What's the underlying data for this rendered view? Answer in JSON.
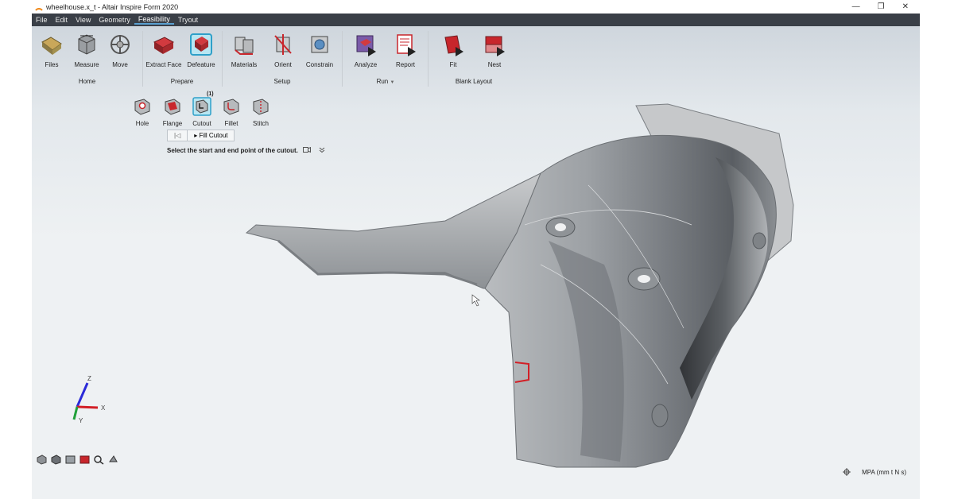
{
  "window": {
    "title": "wheelhouse.x_t - Altair Inspire Form 2020",
    "controls": [
      "—",
      "❐",
      "✕"
    ]
  },
  "menu": [
    "File",
    "Edit",
    "View",
    "Geometry",
    "Feasibility",
    "Tryout"
  ],
  "ribbon": {
    "tools": {
      "files": "Files",
      "measure": "Measure",
      "move": "Move",
      "extract_face": "Extract Face",
      "defeature": "Defeature",
      "materials": "Materials",
      "orient": "Orient",
      "constrain": "Constrain",
      "analyze": "Analyze",
      "report": "Report",
      "fit": "Fit",
      "nest": "Nest"
    },
    "groups": {
      "home": "Home",
      "prepare": "Prepare",
      "setup": "Setup",
      "run": "Run",
      "run_arrow": "▼",
      "blank_layout": "Blank Layout"
    }
  },
  "defeature": {
    "tools": {
      "hole": "Hole",
      "flange": "Flange",
      "cutout": "Cutout",
      "fillet": "Fillet",
      "stitch": "Stitch"
    },
    "cutout_badge": "(1)",
    "fill_button": "▸ Fill Cutout",
    "back_icon": "|◁"
  },
  "prompt": "Select the start and end point of the cutout.",
  "axes": {
    "z": "Z",
    "x": "X",
    "y": "Y"
  },
  "status": {
    "units": "MPA (mm t N s)"
  },
  "colors": {
    "menubar": "#3a3f47",
    "accent": "#5aa0d0",
    "icon_red": "#c8262c"
  }
}
